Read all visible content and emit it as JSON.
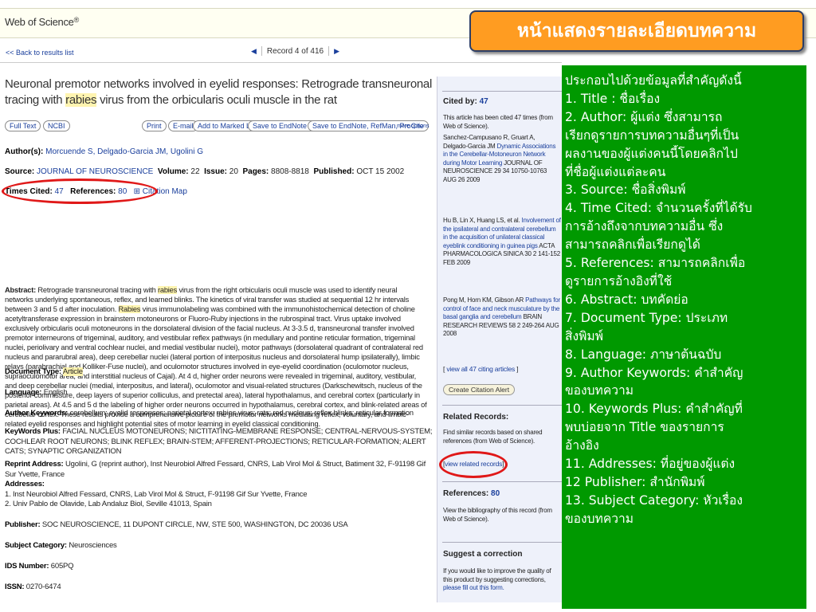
{
  "header": {
    "logo": "Web of Science",
    "logo_mark": "®",
    "back_link": "<< Back to results list",
    "record_text": "Record 4 of 416"
  },
  "banner": {
    "text": "หน้าแสดงรายละเอียดบทความ"
  },
  "article": {
    "title_part1": "Neuronal premotor networks involved in eyelid responses: Retrograde transneuronal tracing with ",
    "title_highlight": "rabies",
    "title_part2": " virus from the orbicularis oculi muscle in the rat",
    "buttons": {
      "full_text": "Full Text",
      "ncbi": "NCBI",
      "print": "Print",
      "email": "E-mail",
      "add_marked": "Add to Marked List",
      "save_endnote_web": "Save to EndNote Web",
      "save_endnote_refman": "Save to EndNote, RefMan, ProCite",
      "more_options": "more options"
    },
    "authors_label": "Author(s):",
    "authors": "Morcuende S, Delgado-Garcia JM, Ugolini G",
    "source_label": "Source:",
    "source": "JOURNAL OF NEUROSCIENCE",
    "volume_label": "Volume:",
    "volume": "22",
    "issue_label": "Issue:",
    "issue": "20",
    "pages_label": "Pages:",
    "pages": "8808-8818",
    "published_label": "Published:",
    "published": "OCT 15 2002",
    "times_cited_label": "Times Cited:",
    "times_cited": "47",
    "references_label": "References:",
    "references": "80",
    "citation_map": "Citation Map",
    "abstract_label": "Abstract:",
    "abstract": "Retrograde transneuronal tracing with rabies virus from the right orbicularis oculi muscle was used to identify neural networks underlying spontaneous, reflex, and learned blinks. The kinetics of viral transfer was studied at sequential 12 hr intervals between 3 and 5 d after inoculation. Rabies virus immunolabeling was combined with the immunohistochemical detection of choline acetyltransferase expression in brainstem motoneurons or Fluoro-Ruby injections in the rubrospinal tract. Virus uptake involved exclusively orbicularis oculi motoneurons in the dorsolateral division of the facial nucleus. At 3-3.5 d, transneuronal transfer involved premotor interneurons of trigeminal, auditory, and vestibular reflex pathways (in medullary and pontine reticular formation, trigeminal nuclei, periolivary and ventral cochlear nuclei, and medial vestibular nuclei), motor pathways (dorsolateral quadrant of contralateral red nucleus and pararubral area), deep cerebellar nuclei (lateral portion of interpositus nucleus and dorsolateral hump ipsilaterally), limbic relays (parabrachial and Kolliker-Fuse nuclei), and oculomotor structures involved in eye-eyelid coordination (oculomotor nucleus, supraoculomotor area, and interstitial nucleus of Cajal). At 4 d, higher order neurons were revealed in trigeminal, auditory, vestibular, and deep cerebellar nuclei (medial, interpositus, and lateral), oculomotor and visual-related structures (Darkschewitsch, nucleus of the posterior commissure, deep layers of superior colliculus, and pretectal area), lateral hypothalamus, and cerebral cortex (particularly in parietal areas). At 4.5 and 5 d the labeling of higher order neurons occurred in hypothalamus, cerebral cortex, and blink-related areas of cerebellar cortex. These results provide a comprehensive picture of the premotor networks mediating reflex, voluntary, and limbic-related eyelid responses and highlight potential sites of motor learning in eyelid classical conditioning.",
    "doc_type_label": "Document Type:",
    "doc_type": "Article",
    "language_label": "Language:",
    "language": "English",
    "author_keywords_label": "Author Keywords:",
    "author_keywords": "cerebellum; eyelid responses; parietal cortex; rabies virus; rats; red nucleus; reflex blinks; reticular formation",
    "keywords_plus_label": "KeyWords Plus:",
    "keywords_plus": "FACIAL NUCLEUS MOTONEURONS; NICTITATING-MEMBRANE RESPONSE; CENTRAL-NERVOUS-SYSTEM; COCHLEAR ROOT NEURONS; BLINK REFLEX; BRAIN-STEM; AFFERENT-PROJECTIONS; RETICULAR-FORMATION; ALERT CATS; SYNAPTIC ORGANIZATION",
    "reprint_label": "Reprint Address:",
    "reprint": "Ugolini, G (reprint author), Inst Neurobiol Alfred Fessard, CNRS, Lab Virol Mol & Struct, Batiment 32, F-91198 Gif Sur Yvette, France",
    "addresses_label": "Addresses:",
    "address1": "1. Inst Neurobiol Alfred Fessard, CNRS, Lab Virol Mol & Struct, F-91198 Gif Sur Yvette, France",
    "address2": "2. Univ Pablo de Olavide, Lab Andaluz Biol, Seville 41013, Spain",
    "publisher_label": "Publisher:",
    "publisher": "SOC NEUROSCIENCE, 11 DUPONT CIRCLE, NW, STE 500, WASHINGTON, DC 20036 USA",
    "subject_label": "Subject Category:",
    "subject": "Neurosciences",
    "ids_label": "IDS Number:",
    "ids": "605PQ",
    "issn_label": "ISSN:",
    "issn": "0270-6474"
  },
  "sidebar": {
    "cited_by_label": "Cited by:",
    "cited_by_count": "47",
    "cited_desc": "This article has been cited 47 times (from Web of Science).",
    "citations": [
      {
        "authors": "Sanchez-Campusano R, Gruart A, Delgado-Garcia JM",
        "title": "Dynamic Associations in the Cerebellar-Motoneuron Network during Motor Learning",
        "source": "JOURNAL OF NEUROSCIENCE 29 34 10750-10763 AUG 26 2009"
      },
      {
        "authors": "Hu B, Lin X, Huang LS, et al.",
        "title": "Involvement of the ipsilateral and contralateral cerebellum in the acquisition of unilateral classical eyeblink conditioning in guinea pigs",
        "source": "ACTA PHARMACOLOGICA SINICA 30 2 141-152 FEB 2009"
      },
      {
        "authors": "Pong M, Horn KM, Gibson AR",
        "title": "Pathways for control of face and neck musculature by the basal ganglia and cerebellum",
        "source": "BRAIN RESEARCH REVIEWS 58 2 249-264 AUG 2008"
      }
    ],
    "view_all": "view all 47 citing articles",
    "create_alert": "Create Citation Alert",
    "related_heading": "Related Records:",
    "related_desc": "Find similar records based on shared references (from Web of Science).",
    "view_related": "view related records",
    "references_label": "References:",
    "references_count": "80",
    "references_desc": "View the bibliography of this record (from Web of Science).",
    "suggest_heading": "Suggest a correction",
    "suggest_desc": "If you would like to improve the quality of this product by suggesting corrections,",
    "suggest_link": "please fill out this form."
  },
  "explanation": {
    "lines": [
      "ประกอบไปด้วยข้อมูลที่สำคัญดังนี้",
      "1. Title : ชื่อเรื่อง",
      "2. Author: ผู้แต่ง ซึ่งสามารถ",
      "เรียกดูรายการบทความอื่นๆที่เป็น",
      "ผลงานของผู้แต่งคนนี้โดยคลิกไป",
      "ที่ชื่อผู้แต่งแต่ละคน",
      "3. Source: ชื่อสิ่งพิมพ์",
      "4. Time Cited: จำนวนครั้งที่ได้รับ",
      "การอ้างถึงจากบทความอื่น ซึ่ง",
      "สามารถคลิกเพื่อเรียกดูได้",
      "5. References: สามารถคลิกเพื่อ",
      "ดูรายการอ้างอิงที่ใช้",
      "6. Abstract: บทคัดย่อ",
      "7. Document Type: ประเภท",
      "สิ่งพิมพ์",
      "8. Language: ภาษาต้นฉบับ",
      "9. Author Keywords: คำสำคัญ",
      "ของบทความ",
      "10. Keywords Plus: คำสำคัญที่",
      "พบบ่อยจาก Title ของรายการ",
      "อ้างอิง",
      "11. Addresses: ที่อยู่ของผู้แต่ง",
      "12 Publisher: สำนักพิมพ์",
      "13. Subject Category: หัวเรื่อง",
      "ของบทความ"
    ]
  },
  "colors": {
    "banner_bg": "#ff9c21",
    "explanation_bg": "#009900",
    "link": "#1a3f9c",
    "annotation_oval": "#e01818",
    "highlight": "#fff4b0"
  }
}
